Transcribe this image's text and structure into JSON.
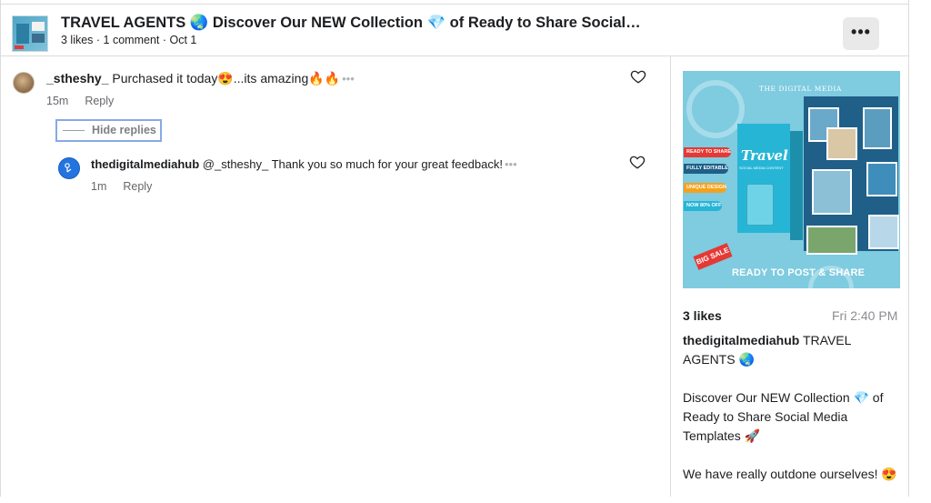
{
  "post": {
    "title": "TRAVEL AGENTS 🌏  Discover Our NEW Collection 💎  of Ready to Share Social…",
    "meta": "3 likes · 1 comment · Oct 1",
    "more_label": "•••"
  },
  "comments": [
    {
      "username": "_stheshy_",
      "text": " Purchased it today😍...its amazing🔥🔥",
      "time": "15m",
      "reply_label": "Reply"
    }
  ],
  "replies_toggle": "Hide replies",
  "replies": [
    {
      "username": "thedigitalmediahub",
      "text": " @_stheshy_ Thank you so much for your great feedback!",
      "time": "1m",
      "reply_label": "Reply"
    }
  ],
  "options_dots": "•••",
  "media": {
    "brand": "THE DIGITAL MEDIA",
    "headline": "Travel",
    "subline": "SOCIAL MEDIA CONTENT",
    "pills": [
      "READY TO SHARE",
      "FULLY EDITABLE",
      "UNIQUE DESIGN",
      "NOW 80% OFF"
    ],
    "pill_colors": [
      "#e53935",
      "#1f5f88",
      "#f4a21d",
      "#27b5d6"
    ],
    "sale": "BIG SALE",
    "footer": "READY TO POST & SHARE"
  },
  "sidebar": {
    "likes": "3 likes",
    "time": "Fri 2:40 PM",
    "caption_user": "thedigitalmediahub",
    "caption_first": " TRAVEL AGENTS 🌏",
    "caption_2": "Discover Our NEW Collection 💎 of Ready to Share Social Media Templates 🚀",
    "caption_3": "We have really outdone ourselves! 😍"
  }
}
